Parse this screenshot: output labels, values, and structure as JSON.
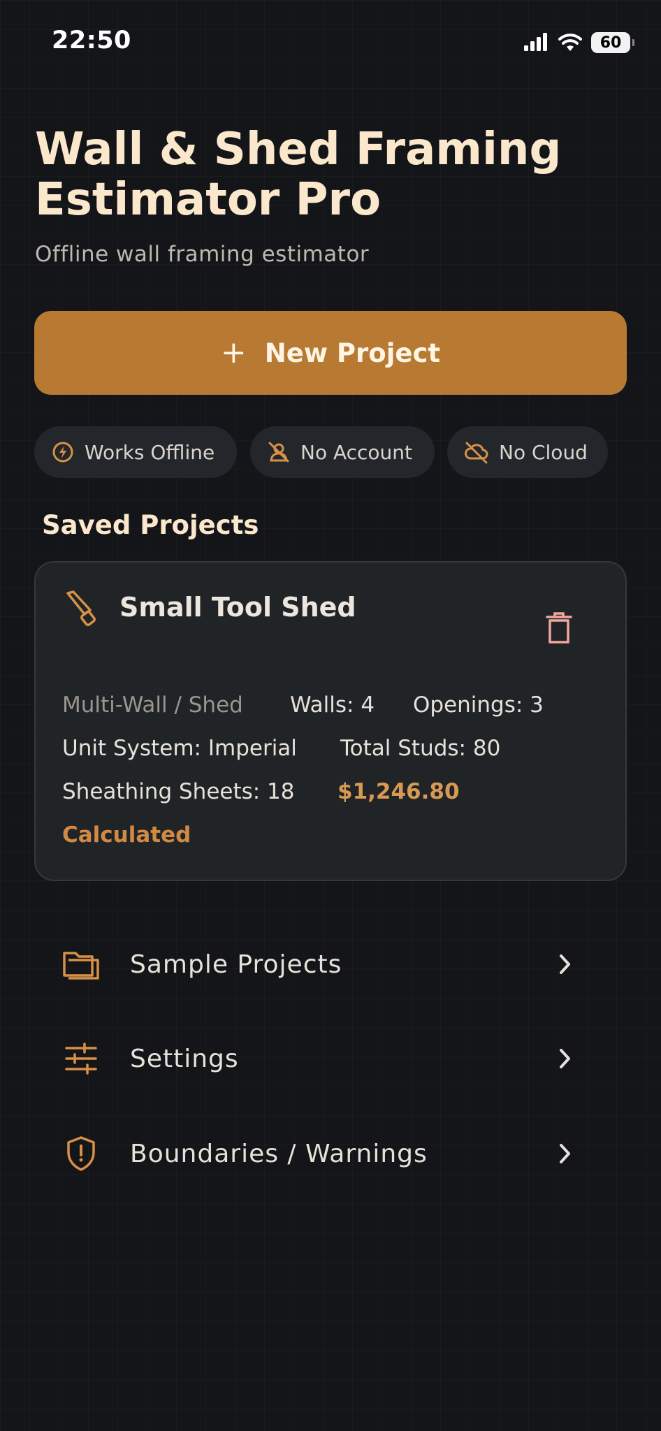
{
  "status_bar": {
    "time": "22:50",
    "battery": "60"
  },
  "header": {
    "title": "Wall & Shed Framing Estimator Pro",
    "subtitle": "Offline wall framing estimator"
  },
  "new_project_button": {
    "icon": "plus-icon",
    "label": "New Project"
  },
  "chips": [
    {
      "label": "Works Offline",
      "icon": "lightning-icon"
    },
    {
      "label": "No Account",
      "icon": "user-off-icon"
    },
    {
      "label": "No Cloud",
      "icon": "cloud-off-icon"
    }
  ],
  "saved_projects": {
    "heading": "Saved Projects",
    "items": [
      {
        "name": "Small Tool Shed",
        "type": "Multi-Wall / Shed",
        "walls": "Walls: 4",
        "openings": "Openings: 3",
        "unit_system": "Unit System: Imperial",
        "total_studs": "Total Studs: 80",
        "sheathing": "Sheathing Sheets: 18",
        "total": "$1,246.80",
        "status": "Calculated"
      }
    ]
  },
  "menu": [
    {
      "label": "Sample Projects",
      "icon": "folder-icon"
    },
    {
      "label": "Settings",
      "icon": "sliders-icon"
    },
    {
      "label": "Boundaries / Warnings",
      "icon": "shield-alert-icon"
    }
  ],
  "colors": {
    "background": "#141518",
    "accent": "#b87a33",
    "title": "#fbe8cc",
    "card": "#212427",
    "delete": "#f0a7a0"
  }
}
